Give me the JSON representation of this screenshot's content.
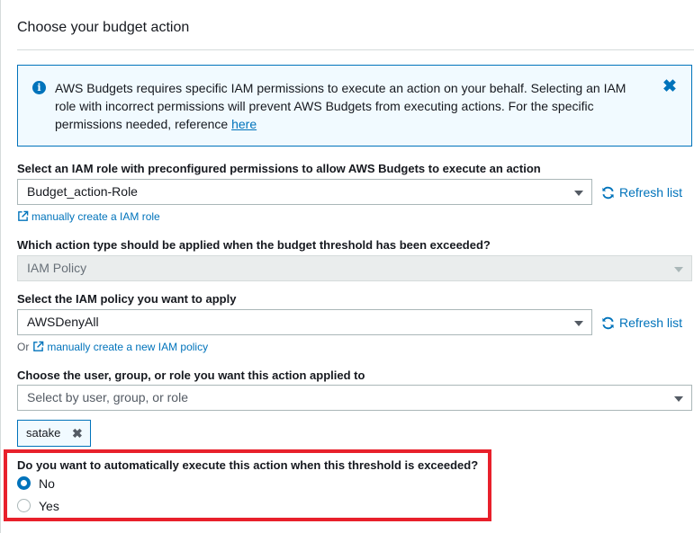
{
  "section": {
    "title": "Choose your budget action"
  },
  "info": {
    "text": "AWS Budgets requires specific IAM permissions to execute an action on your behalf. Selecting an IAM role with incorrect permissions will prevent AWS Budgets from executing actions. For the specific permissions needed, reference ",
    "link": "here",
    "close": "✖"
  },
  "role": {
    "label": "Select an IAM role with preconfigured permissions to allow AWS Budgets to execute an action",
    "value": "Budget_action-Role",
    "refresh": "Refresh list",
    "create_link": "manually create a IAM role"
  },
  "action_type": {
    "label": "Which action type should be applied when the budget threshold has been exceeded?",
    "value": "IAM Policy"
  },
  "policy": {
    "label": "Select the IAM policy you want to apply",
    "value": "AWSDenyAll",
    "refresh": "Refresh list",
    "or": "Or",
    "create_link": "manually create a new IAM policy"
  },
  "target": {
    "label": "Choose the user, group, or role you want this action applied to",
    "placeholder": "Select by user, group, or role",
    "tokens": [
      {
        "label": "satake",
        "remove": "✖"
      }
    ]
  },
  "auto_execute": {
    "question": "Do you want to automatically execute this action when this threshold is exceeded?",
    "options": [
      {
        "label": "No",
        "selected": true
      },
      {
        "label": "Yes",
        "selected": false
      }
    ]
  },
  "colors": {
    "accent": "#0073bb",
    "highlight": "#e8202b",
    "info_bg": "#f1faff"
  }
}
